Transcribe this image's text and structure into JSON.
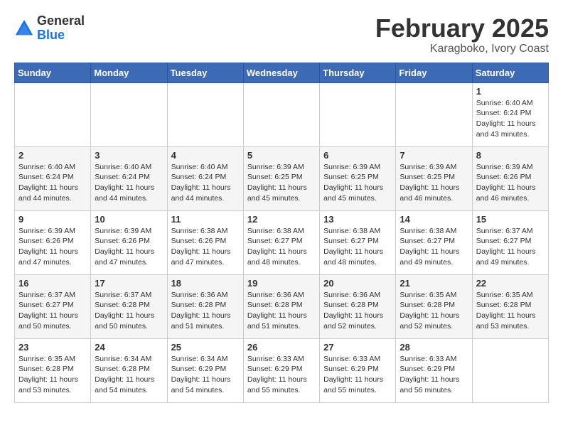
{
  "logo": {
    "general": "General",
    "blue": "Blue"
  },
  "title": "February 2025",
  "location": "Karagboko, Ivory Coast",
  "weekdays": [
    "Sunday",
    "Monday",
    "Tuesday",
    "Wednesday",
    "Thursday",
    "Friday",
    "Saturday"
  ],
  "weeks": [
    [
      {
        "day": "",
        "info": ""
      },
      {
        "day": "",
        "info": ""
      },
      {
        "day": "",
        "info": ""
      },
      {
        "day": "",
        "info": ""
      },
      {
        "day": "",
        "info": ""
      },
      {
        "day": "",
        "info": ""
      },
      {
        "day": "1",
        "info": "Sunrise: 6:40 AM\nSunset: 6:24 PM\nDaylight: 11 hours\nand 43 minutes."
      }
    ],
    [
      {
        "day": "2",
        "info": "Sunrise: 6:40 AM\nSunset: 6:24 PM\nDaylight: 11 hours\nand 44 minutes."
      },
      {
        "day": "3",
        "info": "Sunrise: 6:40 AM\nSunset: 6:24 PM\nDaylight: 11 hours\nand 44 minutes."
      },
      {
        "day": "4",
        "info": "Sunrise: 6:40 AM\nSunset: 6:24 PM\nDaylight: 11 hours\nand 44 minutes."
      },
      {
        "day": "5",
        "info": "Sunrise: 6:39 AM\nSunset: 6:25 PM\nDaylight: 11 hours\nand 45 minutes."
      },
      {
        "day": "6",
        "info": "Sunrise: 6:39 AM\nSunset: 6:25 PM\nDaylight: 11 hours\nand 45 minutes."
      },
      {
        "day": "7",
        "info": "Sunrise: 6:39 AM\nSunset: 6:25 PM\nDaylight: 11 hours\nand 46 minutes."
      },
      {
        "day": "8",
        "info": "Sunrise: 6:39 AM\nSunset: 6:26 PM\nDaylight: 11 hours\nand 46 minutes."
      }
    ],
    [
      {
        "day": "9",
        "info": "Sunrise: 6:39 AM\nSunset: 6:26 PM\nDaylight: 11 hours\nand 47 minutes."
      },
      {
        "day": "10",
        "info": "Sunrise: 6:39 AM\nSunset: 6:26 PM\nDaylight: 11 hours\nand 47 minutes."
      },
      {
        "day": "11",
        "info": "Sunrise: 6:38 AM\nSunset: 6:26 PM\nDaylight: 11 hours\nand 47 minutes."
      },
      {
        "day": "12",
        "info": "Sunrise: 6:38 AM\nSunset: 6:27 PM\nDaylight: 11 hours\nand 48 minutes."
      },
      {
        "day": "13",
        "info": "Sunrise: 6:38 AM\nSunset: 6:27 PM\nDaylight: 11 hours\nand 48 minutes."
      },
      {
        "day": "14",
        "info": "Sunrise: 6:38 AM\nSunset: 6:27 PM\nDaylight: 11 hours\nand 49 minutes."
      },
      {
        "day": "15",
        "info": "Sunrise: 6:37 AM\nSunset: 6:27 PM\nDaylight: 11 hours\nand 49 minutes."
      }
    ],
    [
      {
        "day": "16",
        "info": "Sunrise: 6:37 AM\nSunset: 6:27 PM\nDaylight: 11 hours\nand 50 minutes."
      },
      {
        "day": "17",
        "info": "Sunrise: 6:37 AM\nSunset: 6:28 PM\nDaylight: 11 hours\nand 50 minutes."
      },
      {
        "day": "18",
        "info": "Sunrise: 6:36 AM\nSunset: 6:28 PM\nDaylight: 11 hours\nand 51 minutes."
      },
      {
        "day": "19",
        "info": "Sunrise: 6:36 AM\nSunset: 6:28 PM\nDaylight: 11 hours\nand 51 minutes."
      },
      {
        "day": "20",
        "info": "Sunrise: 6:36 AM\nSunset: 6:28 PM\nDaylight: 11 hours\nand 52 minutes."
      },
      {
        "day": "21",
        "info": "Sunrise: 6:35 AM\nSunset: 6:28 PM\nDaylight: 11 hours\nand 52 minutes."
      },
      {
        "day": "22",
        "info": "Sunrise: 6:35 AM\nSunset: 6:28 PM\nDaylight: 11 hours\nand 53 minutes."
      }
    ],
    [
      {
        "day": "23",
        "info": "Sunrise: 6:35 AM\nSunset: 6:28 PM\nDaylight: 11 hours\nand 53 minutes."
      },
      {
        "day": "24",
        "info": "Sunrise: 6:34 AM\nSunset: 6:28 PM\nDaylight: 11 hours\nand 54 minutes."
      },
      {
        "day": "25",
        "info": "Sunrise: 6:34 AM\nSunset: 6:29 PM\nDaylight: 11 hours\nand 54 minutes."
      },
      {
        "day": "26",
        "info": "Sunrise: 6:33 AM\nSunset: 6:29 PM\nDaylight: 11 hours\nand 55 minutes."
      },
      {
        "day": "27",
        "info": "Sunrise: 6:33 AM\nSunset: 6:29 PM\nDaylight: 11 hours\nand 55 minutes."
      },
      {
        "day": "28",
        "info": "Sunrise: 6:33 AM\nSunset: 6:29 PM\nDaylight: 11 hours\nand 56 minutes."
      },
      {
        "day": "",
        "info": ""
      }
    ]
  ]
}
